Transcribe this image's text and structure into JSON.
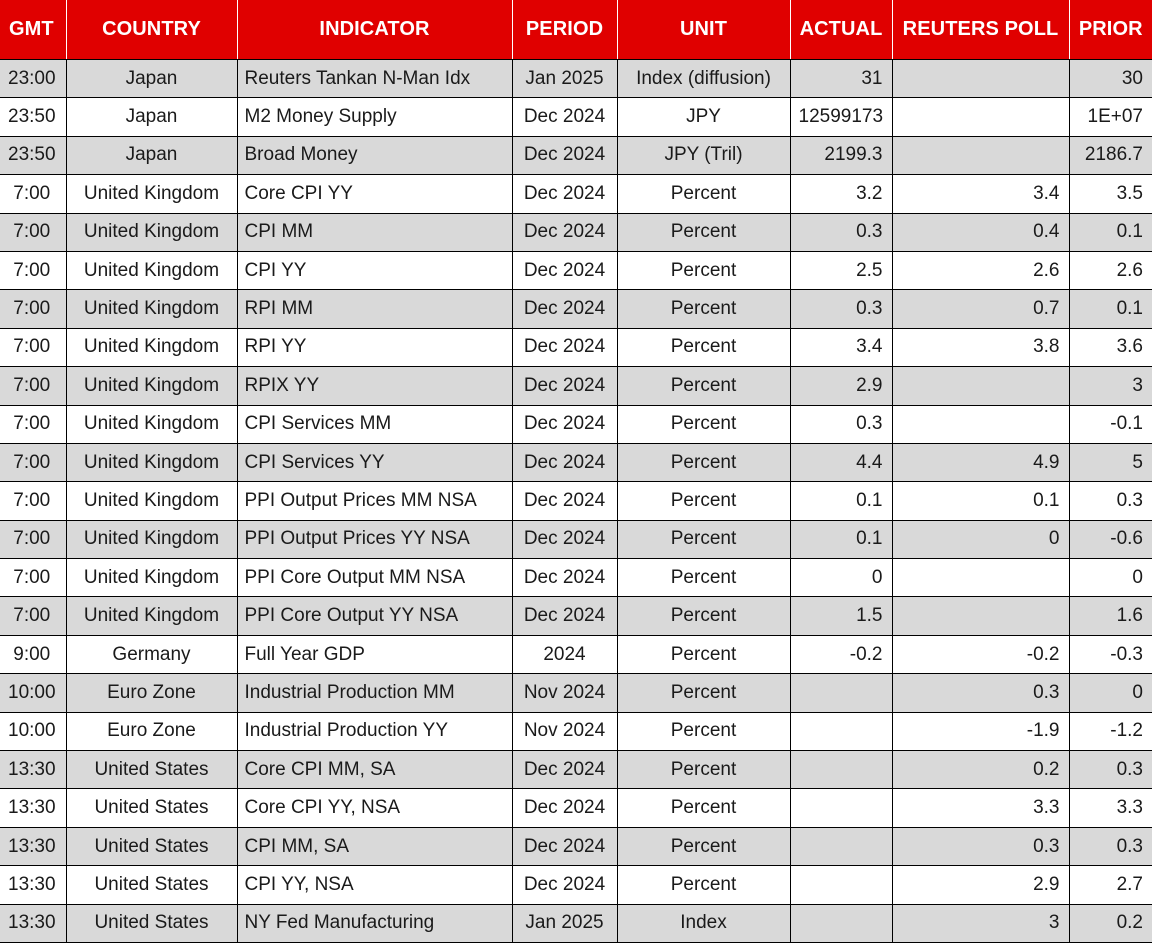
{
  "table": {
    "accent_color": "#E00000",
    "header_text_color": "#FFFFFF",
    "stripe_color": "#D9D9D9",
    "base_color": "#FFFFFF",
    "grid_color": "#000000",
    "columns": [
      {
        "key": "gmt",
        "label": "GMT",
        "align": "left"
      },
      {
        "key": "country",
        "label": "COUNTRY",
        "align": "center"
      },
      {
        "key": "indicator",
        "label": "INDICATOR",
        "align": "center"
      },
      {
        "key": "period",
        "label": "PERIOD",
        "align": "center"
      },
      {
        "key": "unit",
        "label": "UNIT",
        "align": "center"
      },
      {
        "key": "actual",
        "label": "ACTUAL",
        "align": "center"
      },
      {
        "key": "poll",
        "label": "REUTERS POLL",
        "align": "center"
      },
      {
        "key": "prior",
        "label": "PRIOR",
        "align": "center"
      }
    ],
    "rows": [
      {
        "gmt": "23:00",
        "country": "Japan",
        "indicator": "Reuters Tankan N-Man Idx",
        "period": "Jan 2025",
        "unit": "Index (diffusion)",
        "actual": "31",
        "poll": "",
        "prior": "30"
      },
      {
        "gmt": "23:50",
        "country": "Japan",
        "indicator": "M2 Money Supply",
        "period": "Dec 2024",
        "unit": "JPY",
        "actual": "12599173",
        "poll": "",
        "prior": "1E+07"
      },
      {
        "gmt": "23:50",
        "country": "Japan",
        "indicator": "Broad Money",
        "period": "Dec 2024",
        "unit": "JPY (Tril)",
        "actual": "2199.3",
        "poll": "",
        "prior": "2186.7"
      },
      {
        "gmt": "7:00",
        "country": "United Kingdom",
        "indicator": "Core CPI YY",
        "period": "Dec 2024",
        "unit": "Percent",
        "actual": "3.2",
        "poll": "3.4",
        "prior": "3.5"
      },
      {
        "gmt": "7:00",
        "country": "United Kingdom",
        "indicator": "CPI MM",
        "period": "Dec 2024",
        "unit": "Percent",
        "actual": "0.3",
        "poll": "0.4",
        "prior": "0.1"
      },
      {
        "gmt": "7:00",
        "country": "United Kingdom",
        "indicator": "CPI YY",
        "period": "Dec 2024",
        "unit": "Percent",
        "actual": "2.5",
        "poll": "2.6",
        "prior": "2.6"
      },
      {
        "gmt": "7:00",
        "country": "United Kingdom",
        "indicator": "RPI MM",
        "period": "Dec 2024",
        "unit": "Percent",
        "actual": "0.3",
        "poll": "0.7",
        "prior": "0.1"
      },
      {
        "gmt": "7:00",
        "country": "United Kingdom",
        "indicator": "RPI YY",
        "period": "Dec 2024",
        "unit": "Percent",
        "actual": "3.4",
        "poll": "3.8",
        "prior": "3.6"
      },
      {
        "gmt": "7:00",
        "country": "United Kingdom",
        "indicator": "RPIX YY",
        "period": "Dec 2024",
        "unit": "Percent",
        "actual": "2.9",
        "poll": "",
        "prior": "3"
      },
      {
        "gmt": "7:00",
        "country": "United Kingdom",
        "indicator": "CPI Services MM",
        "period": "Dec 2024",
        "unit": "Percent",
        "actual": "0.3",
        "poll": "",
        "prior": "-0.1"
      },
      {
        "gmt": "7:00",
        "country": "United Kingdom",
        "indicator": "CPI Services YY",
        "period": "Dec 2024",
        "unit": "Percent",
        "actual": "4.4",
        "poll": "4.9",
        "prior": "5"
      },
      {
        "gmt": "7:00",
        "country": "United Kingdom",
        "indicator": "PPI Output Prices MM NSA",
        "period": "Dec 2024",
        "unit": "Percent",
        "actual": "0.1",
        "poll": "0.1",
        "prior": "0.3"
      },
      {
        "gmt": "7:00",
        "country": "United Kingdom",
        "indicator": "PPI Output Prices YY NSA",
        "period": "Dec 2024",
        "unit": "Percent",
        "actual": "0.1",
        "poll": "0",
        "prior": "-0.6"
      },
      {
        "gmt": "7:00",
        "country": "United Kingdom",
        "indicator": "PPI Core Output MM NSA",
        "period": "Dec 2024",
        "unit": "Percent",
        "actual": "0",
        "poll": "",
        "prior": "0"
      },
      {
        "gmt": "7:00",
        "country": "United Kingdom",
        "indicator": "PPI Core Output YY NSA",
        "period": "Dec 2024",
        "unit": "Percent",
        "actual": "1.5",
        "poll": "",
        "prior": "1.6"
      },
      {
        "gmt": "9:00",
        "country": "Germany",
        "indicator": "Full Year GDP",
        "period": "2024",
        "unit": "Percent",
        "actual": "-0.2",
        "poll": "-0.2",
        "prior": "-0.3"
      },
      {
        "gmt": "10:00",
        "country": "Euro Zone",
        "indicator": "Industrial Production MM",
        "period": "Nov 2024",
        "unit": "Percent",
        "actual": "",
        "poll": "0.3",
        "prior": "0"
      },
      {
        "gmt": "10:00",
        "country": "Euro Zone",
        "indicator": "Industrial Production YY",
        "period": "Nov 2024",
        "unit": "Percent",
        "actual": "",
        "poll": "-1.9",
        "prior": "-1.2"
      },
      {
        "gmt": "13:30",
        "country": "United States",
        "indicator": "Core CPI MM, SA",
        "period": "Dec 2024",
        "unit": "Percent",
        "actual": "",
        "poll": "0.2",
        "prior": "0.3"
      },
      {
        "gmt": "13:30",
        "country": "United States",
        "indicator": "Core CPI YY, NSA",
        "period": "Dec 2024",
        "unit": "Percent",
        "actual": "",
        "poll": "3.3",
        "prior": "3.3"
      },
      {
        "gmt": "13:30",
        "country": "United States",
        "indicator": "CPI MM, SA",
        "period": "Dec 2024",
        "unit": "Percent",
        "actual": "",
        "poll": "0.3",
        "prior": "0.3"
      },
      {
        "gmt": "13:30",
        "country": "United States",
        "indicator": "CPI YY, NSA",
        "period": "Dec 2024",
        "unit": "Percent",
        "actual": "",
        "poll": "2.9",
        "prior": "2.7"
      },
      {
        "gmt": "13:30",
        "country": "United States",
        "indicator": "NY Fed Manufacturing",
        "period": "Jan 2025",
        "unit": "Index",
        "actual": "",
        "poll": "3",
        "prior": "0.2"
      }
    ]
  }
}
